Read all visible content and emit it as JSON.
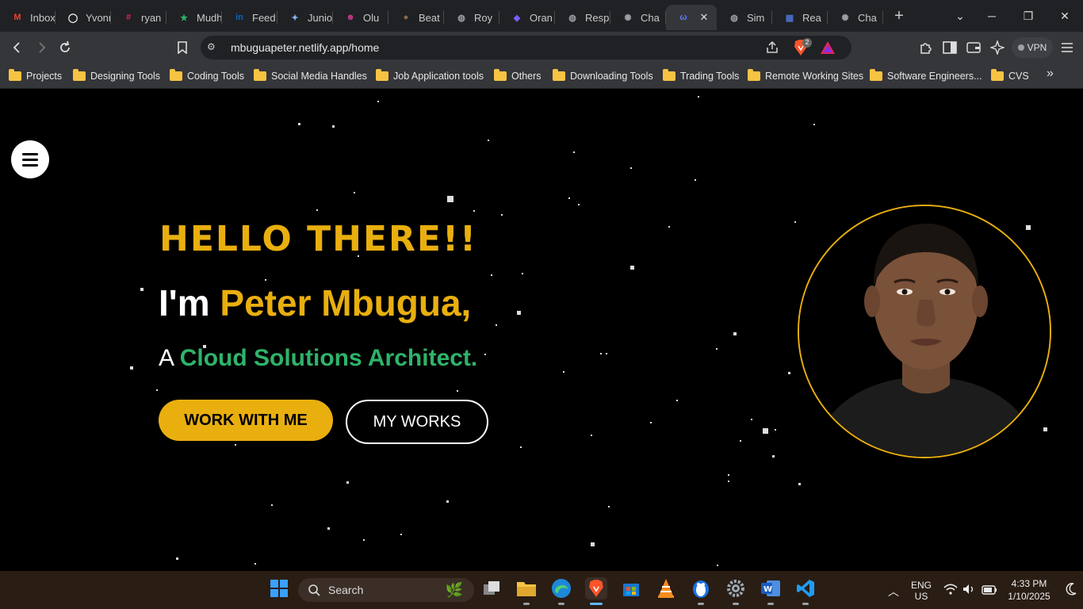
{
  "browser": {
    "tabs": [
      {
        "title": "Inbox",
        "icon": "gmail-icon",
        "color": "#ea4335",
        "glyph": "M"
      },
      {
        "title": "Yvonne",
        "icon": "threads-icon",
        "color": "#ffffff",
        "glyph": "◯"
      },
      {
        "title": "ryan",
        "icon": "slack-icon",
        "color": "#e01e5a",
        "glyph": "#"
      },
      {
        "title": "Mudhe",
        "icon": "star-badge-icon",
        "color": "#2fb36a",
        "glyph": "★"
      },
      {
        "title": "Feed",
        "icon": "linkedin-icon",
        "color": "#0a66c2",
        "glyph": "in"
      },
      {
        "title": "Junior",
        "icon": "sparkle-icon",
        "color": "#8ab4f8",
        "glyph": "✦"
      },
      {
        "title": "Olu",
        "icon": "profile-icon",
        "color": "#c23a8a",
        "glyph": "☻"
      },
      {
        "title": "Beat",
        "icon": "avatar-icon",
        "color": "#8a6a50",
        "glyph": "●"
      },
      {
        "title": "Roy",
        "icon": "globe-icon",
        "color": "#9aa0a6",
        "glyph": "◍"
      },
      {
        "title": "Oran",
        "icon": "shield-app-icon",
        "color": "#7b5cff",
        "glyph": "◆"
      },
      {
        "title": "Resp",
        "icon": "globe-icon",
        "color": "#9aa0a6",
        "glyph": "◍"
      },
      {
        "title": "Cha",
        "icon": "chatgpt-icon",
        "color": "#9aa0a6",
        "glyph": "✺"
      },
      {
        "title": "",
        "icon": "site-icon",
        "color": "#5b7cfa",
        "glyph": "ω",
        "active": true
      },
      {
        "title": "Sim",
        "icon": "globe-icon",
        "color": "#9aa0a6",
        "glyph": "◍"
      },
      {
        "title": "Rea",
        "icon": "building-icon",
        "color": "#4a6fd0",
        "glyph": "▦"
      },
      {
        "title": "Cha",
        "icon": "chatgpt-icon",
        "color": "#9aa0a6",
        "glyph": "✺"
      }
    ],
    "url": "mbuguapeter.netlify.app/home",
    "vpn_label": "VPN",
    "brave_badge": "2",
    "bookmarks": [
      "Projects",
      "Designing Tools",
      "Coding Tools",
      "Social Media Handles",
      "Job Application tools",
      "Others",
      "Downloading Tools",
      "Trading Tools",
      "Remote Working Sites",
      "Software Engineers...",
      "CVS"
    ]
  },
  "hero": {
    "greeting": "HELLO THERE!!",
    "intro_prefix": "I'm ",
    "name": "Peter Mbugua,",
    "role_prefix": "A ",
    "role": "Cloud Solutions Architect.",
    "primary_button": "WORK WITH ME",
    "secondary_button": "MY WORKS",
    "accent_color": "#e9af0f",
    "role_color": "#2fb36a"
  },
  "taskbar": {
    "search_label": "Search",
    "language": "ENG",
    "region": "US",
    "time": "4:33 PM",
    "date": "1/10/2025"
  }
}
